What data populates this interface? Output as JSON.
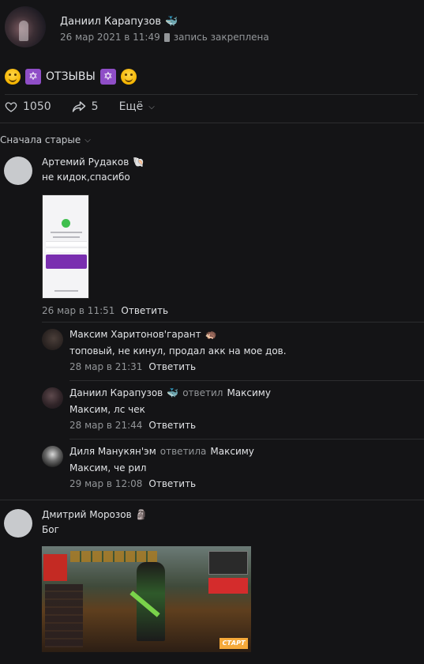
{
  "post": {
    "author": "Даниил Карапузов",
    "author_emoji": "🐳",
    "date": "26 мар 2021 в 11:49",
    "pinned_label": "запись закреплена",
    "text": "ОТЗЫВЫ",
    "likes": "1050",
    "shares": "5",
    "more_label": "Ещё"
  },
  "sort": {
    "label": "Сначала старые"
  },
  "comments": [
    {
      "author": "Артемий Рудаков",
      "emoji": "🐚",
      "text": "не кидок,спасибо",
      "date": "26 мар в 11:51",
      "reply_label": "Ответить"
    },
    {
      "author": "Максим Харитонов'гарант",
      "emoji": "🦔",
      "text": "топовый, не кинул, продал акк на мое дов.",
      "date": "28 мар в 21:31",
      "reply_label": "Ответить"
    },
    {
      "author": "Даниил Карапузов",
      "emoji": "🐳",
      "replied_word": "ответил",
      "replied_to": "Максиму",
      "text": "Максим, лс чек",
      "date": "28 мар в 21:44",
      "reply_label": "Ответить"
    },
    {
      "author": "Диля Манукян'эм",
      "replied_word": "ответила",
      "replied_to": "Максиму",
      "text": "Максим, че рил",
      "date": "29 мар в 12:08",
      "reply_label": "Ответить"
    },
    {
      "author": "Дмитрий Морозов",
      "emoji": "🗿",
      "text": "Бог"
    }
  ],
  "game_attachment": {
    "start_label": "СТАРТ"
  },
  "colors": {
    "background": "#141416",
    "text_primary": "#e1e3e6",
    "text_secondary": "#939699",
    "divider": "#2c2d2f"
  }
}
